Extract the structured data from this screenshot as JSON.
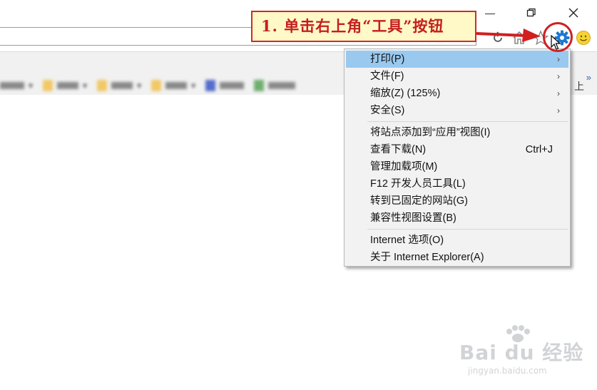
{
  "annotation": {
    "text": "1. 单击右上角“工具”按钮",
    "accent_color": "#cc2b2b",
    "background_color": "#fff8c7"
  },
  "window_controls": [
    "minimize-icon",
    "restore-icon",
    "close-icon"
  ],
  "toolbar_icons": [
    "home-icon",
    "favorites-star-icon",
    "tools-gear-icon",
    "smiley-feedback-icon"
  ],
  "favorites_bar": {
    "overflow_icon": "»",
    "right_text": "上"
  },
  "tools_menu": {
    "items": [
      {
        "label": "打印(P)",
        "submenu": true,
        "highlighted": true
      },
      {
        "label": "文件(F)",
        "submenu": true
      },
      {
        "label": "缩放(Z) (125%)",
        "submenu": true
      },
      {
        "label": "安全(S)",
        "submenu": true
      },
      {
        "label": "将站点添加到“应用”视图(I)"
      },
      {
        "label": "查看下载(N)",
        "shortcut": "Ctrl+J"
      },
      {
        "label": "管理加载项(M)"
      },
      {
        "label": "F12 开发人员工具(L)"
      },
      {
        "label": "转到已固定的网站(G)"
      },
      {
        "label": "兼容性视图设置(B)"
      },
      {
        "label": "Internet 选项(O)"
      },
      {
        "label": "关于 Internet Explorer(A)"
      }
    ],
    "submenu_glyph": "›",
    "highlight_color": "#99c9ef"
  },
  "watermark": {
    "main": "Bai du 经验",
    "sub": "jingyan.baidu.com"
  }
}
